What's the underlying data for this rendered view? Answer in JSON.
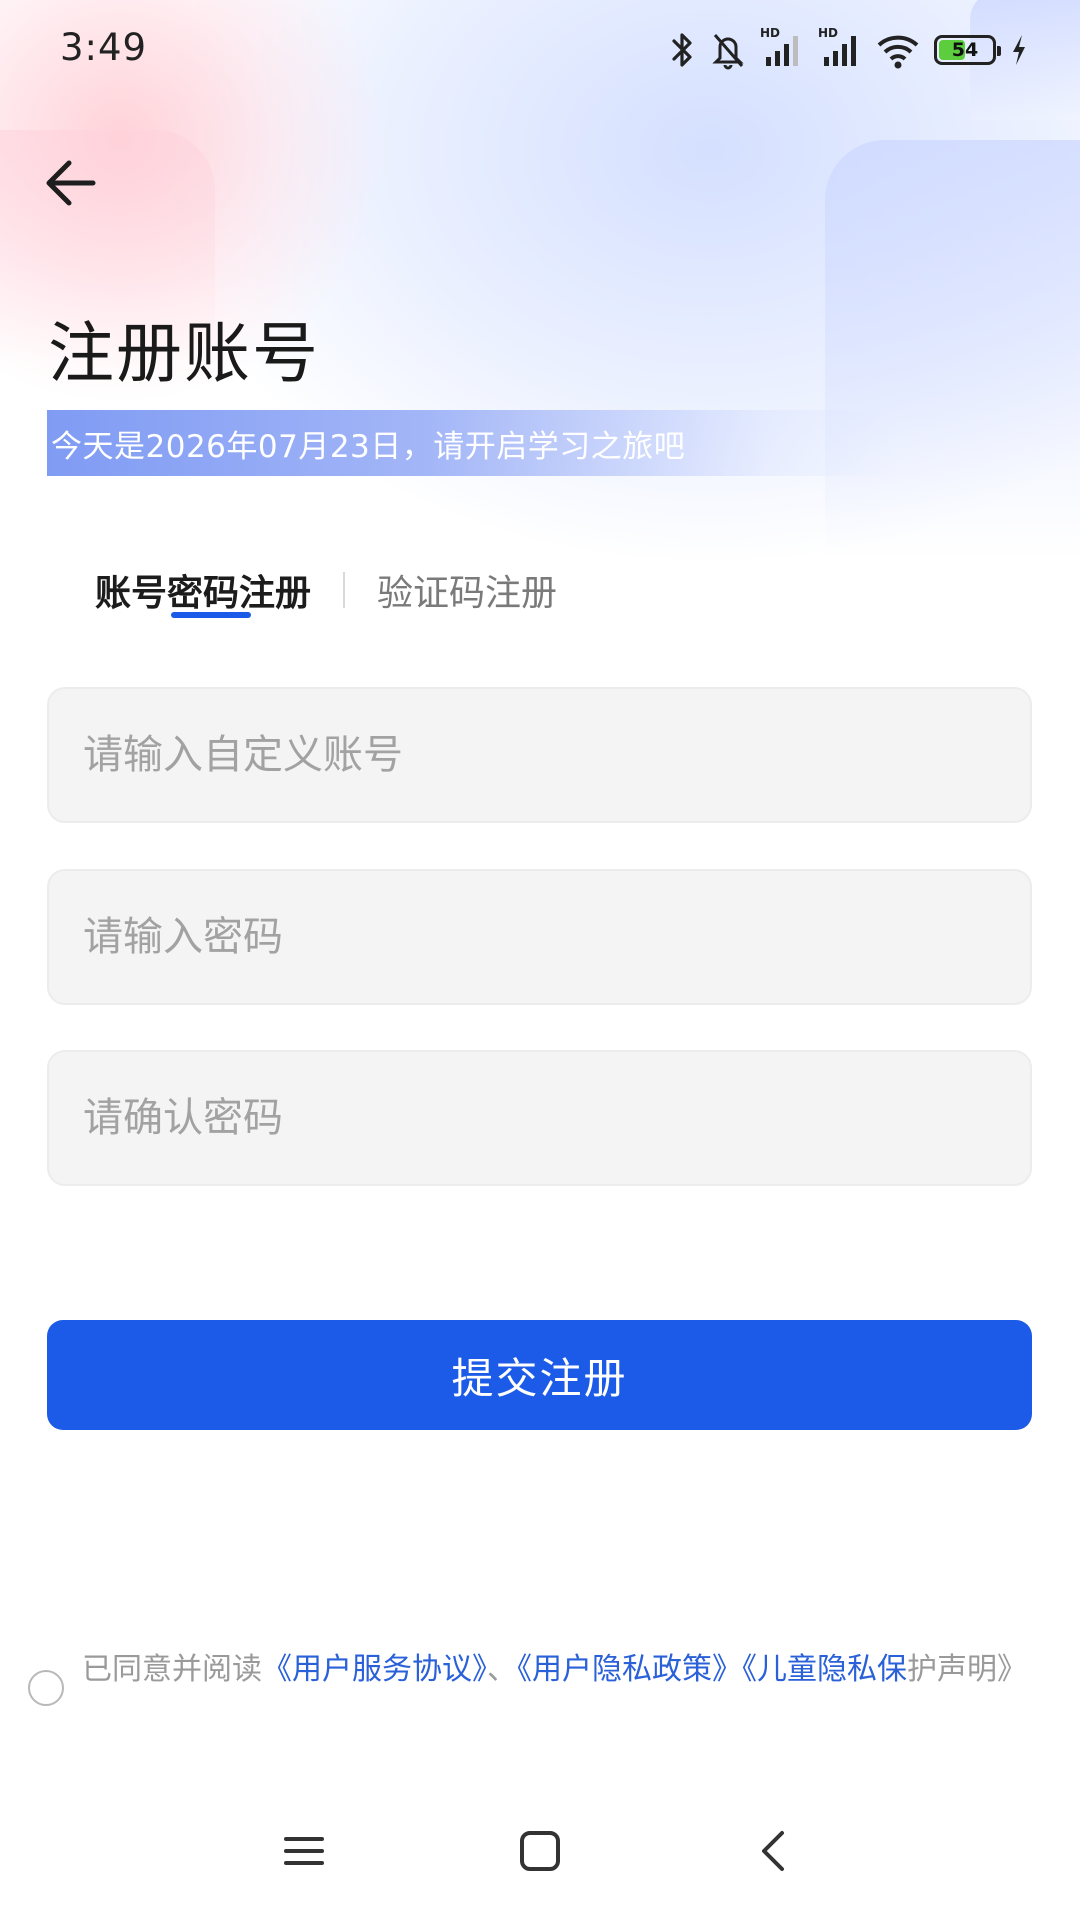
{
  "status_bar": {
    "time": "3:49",
    "network_label_1": "HD",
    "network_label_2": "HD",
    "battery_level": "54",
    "battery_percent": 54,
    "icons": [
      "bluetooth-icon",
      "bell-muted-icon",
      "signal-icon",
      "signal-icon",
      "wifi-icon",
      "battery-icon",
      "charging-icon"
    ]
  },
  "header": {
    "title": "注册账号",
    "date_banner": "今天是2026年07月23日，请开启学习之旅吧"
  },
  "tabs": [
    {
      "label": "账号密码注册",
      "active": true
    },
    {
      "label": "验证码注册",
      "active": false
    }
  ],
  "form": {
    "account_placeholder": "请输入自定义账号",
    "password_placeholder": "请输入密码",
    "confirm_placeholder": "请确认密码",
    "submit_label": "提交注册"
  },
  "agreement": {
    "prefix": "已同意并阅读",
    "user_service": "《用户服务协议》",
    "separator": "、",
    "privacy_policy": "《用户隐私政策》",
    "child_privacy": "《儿童隐私保",
    "suffix": "护声明》",
    "checked": false
  },
  "colors": {
    "accent": "#1c5be8",
    "link": "#2a60d8",
    "input_bg": "#f4f4f4"
  }
}
